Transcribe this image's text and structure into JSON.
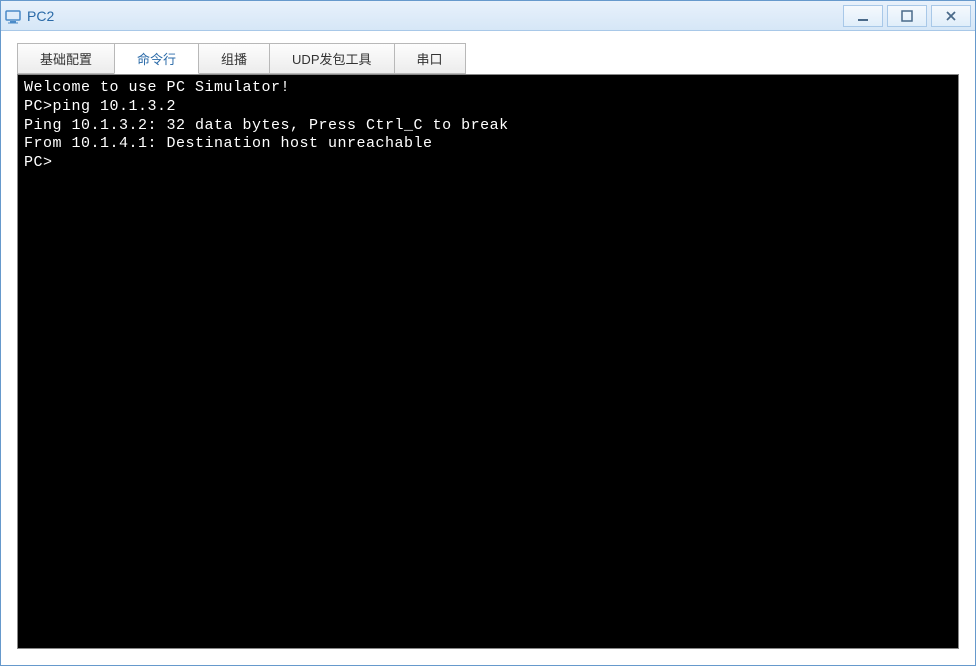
{
  "window": {
    "title": "PC2"
  },
  "tabs": {
    "items": [
      {
        "label": "基础配置",
        "active": false
      },
      {
        "label": "命令行",
        "active": true
      },
      {
        "label": "组播",
        "active": false
      },
      {
        "label": "UDP发包工具",
        "active": false
      },
      {
        "label": "串口",
        "active": false
      }
    ]
  },
  "terminal": {
    "lines": [
      "Welcome to use PC Simulator!",
      "",
      "PC>ping 10.1.3.2",
      "",
      "Ping 10.1.3.2: 32 data bytes, Press Ctrl_C to break",
      "From 10.1.4.1: Destination host unreachable",
      "",
      "PC>"
    ]
  }
}
